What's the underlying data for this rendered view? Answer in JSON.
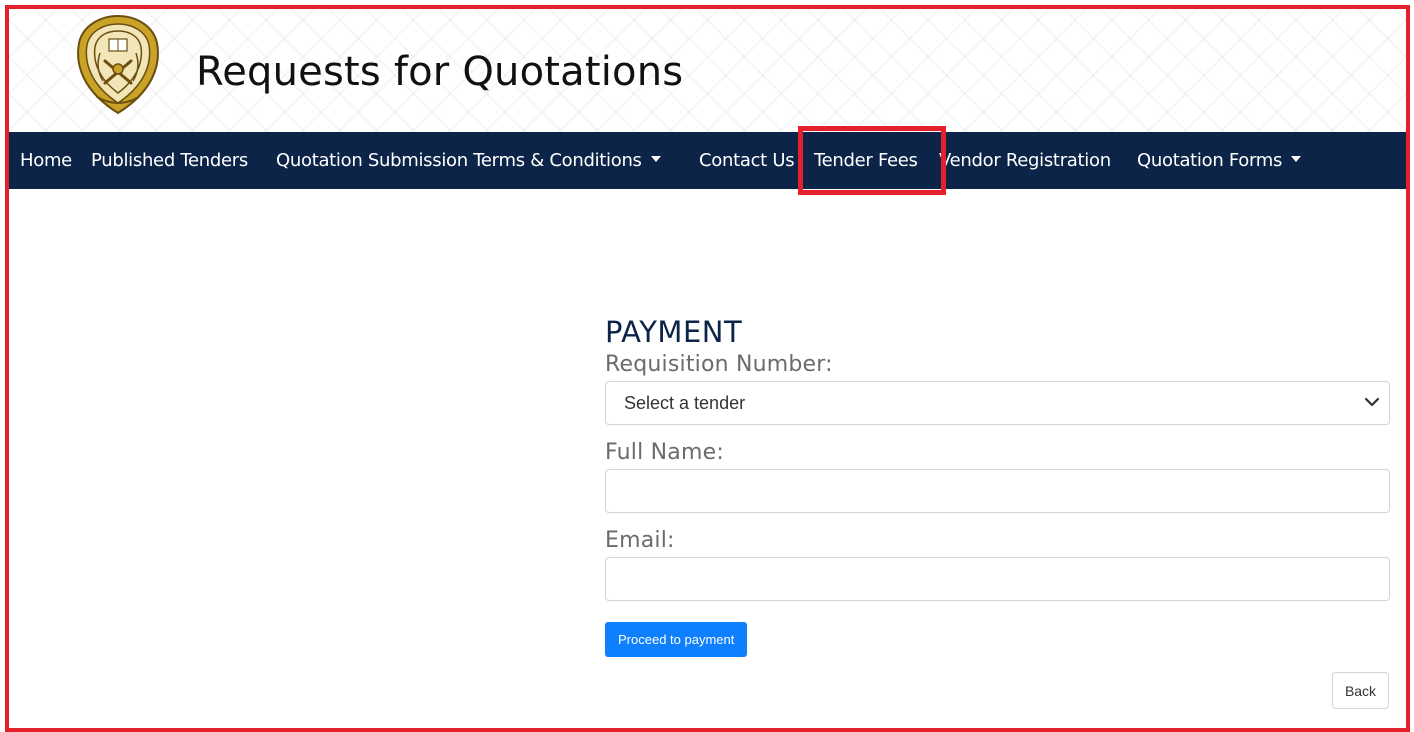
{
  "header": {
    "logo_icon": "university-emblem-icon",
    "title": "Requests for Quotations"
  },
  "nav": {
    "items": [
      {
        "label": "Home",
        "has_dropdown": false
      },
      {
        "label": "Published Tenders",
        "has_dropdown": false
      },
      {
        "label": "Quotation Submission Terms & Conditions",
        "has_dropdown": true
      },
      {
        "label": "Contact Us",
        "has_dropdown": false
      },
      {
        "label": "Tender Fees",
        "has_dropdown": false,
        "highlighted": true
      },
      {
        "label": "Vendor Registration",
        "has_dropdown": false
      },
      {
        "label": "Quotation Forms",
        "has_dropdown": true
      }
    ]
  },
  "form": {
    "heading": "PAYMENT",
    "requisition_label": "Requisition Number:",
    "requisition_selected": "Select a tender",
    "full_name_label": "Full Name:",
    "full_name_value": "",
    "email_label": "Email:",
    "email_value": "",
    "submit_label": "Proceed to payment"
  },
  "back_label": "Back",
  "colors": {
    "navbar": "#0b2447",
    "highlight": "#e3202c",
    "primary_button": "#0d7fff",
    "heading": "#0b2447"
  }
}
